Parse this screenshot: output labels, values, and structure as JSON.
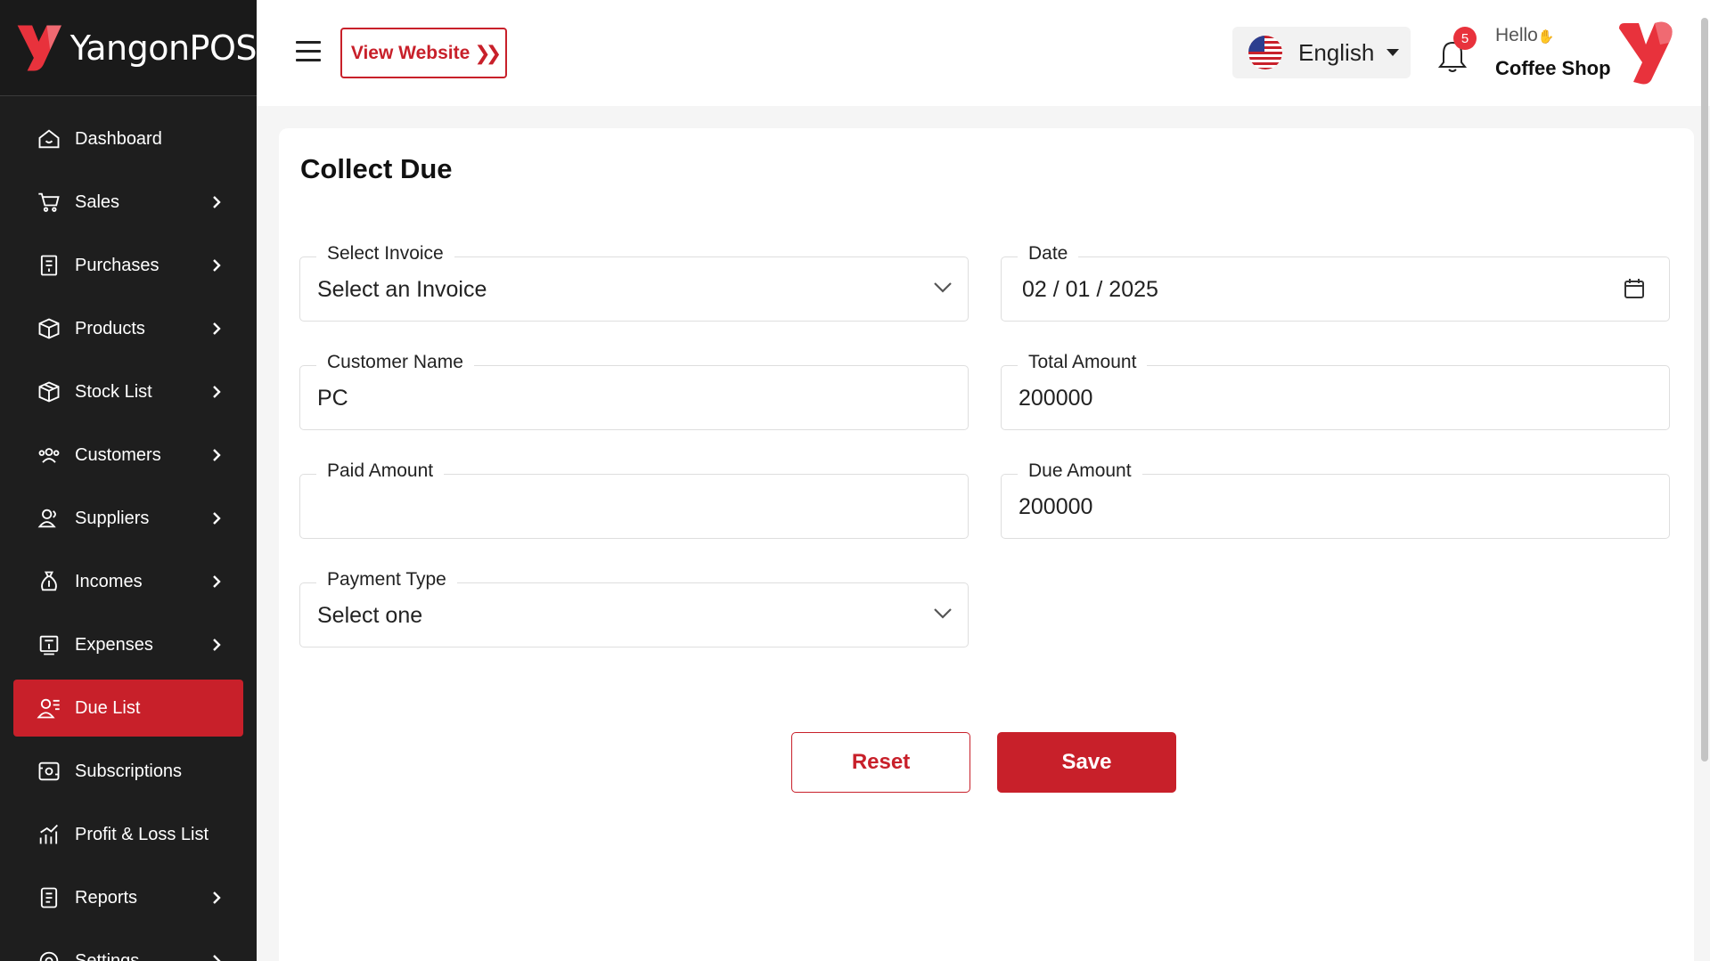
{
  "brand": {
    "name": "YangonPOS",
    "accent": "#c8202a"
  },
  "sidebar": {
    "items": [
      {
        "label": "Dashboard",
        "icon": "home-icon",
        "chevron": false
      },
      {
        "label": "Sales",
        "icon": "cart-icon",
        "chevron": true
      },
      {
        "label": "Purchases",
        "icon": "receipt-icon",
        "chevron": true
      },
      {
        "label": "Products",
        "icon": "box-icon",
        "chevron": true
      },
      {
        "label": "Stock List",
        "icon": "package-icon",
        "chevron": true
      },
      {
        "label": "Customers",
        "icon": "users-icon",
        "chevron": true
      },
      {
        "label": "Suppliers",
        "icon": "user-group-icon",
        "chevron": true
      },
      {
        "label": "Incomes",
        "icon": "money-bag-icon",
        "chevron": true
      },
      {
        "label": "Expenses",
        "icon": "bill-icon",
        "chevron": true
      },
      {
        "label": "Due List",
        "icon": "user-list-icon",
        "chevron": false,
        "active": true
      },
      {
        "label": "Subscriptions",
        "icon": "subscription-icon",
        "chevron": false
      },
      {
        "label": "Profit & Loss List",
        "icon": "chart-icon",
        "chevron": false
      },
      {
        "label": "Reports",
        "icon": "report-icon",
        "chevron": true
      },
      {
        "label": "Settings",
        "icon": "gear-icon",
        "chevron": true
      }
    ]
  },
  "header": {
    "view_website": "View Website",
    "language": "English",
    "notification_count": "5",
    "greeting": "Hello",
    "shop_name": "Coffee Shop"
  },
  "main": {
    "title": "Collect Due",
    "fields": {
      "invoice": {
        "label": "Select Invoice",
        "value": "Select an Invoice"
      },
      "date": {
        "label": "Date",
        "value": "02 / 01 / 2025"
      },
      "customer": {
        "label": "Customer Name",
        "value": "PC"
      },
      "total": {
        "label": "Total Amount",
        "value": "200000"
      },
      "paid": {
        "label": "Paid Amount",
        "value": ""
      },
      "due": {
        "label": "Due Amount",
        "value": "200000"
      },
      "payment_type": {
        "label": "Payment Type",
        "value": "Select one"
      }
    },
    "buttons": {
      "reset": "Reset",
      "save": "Save"
    }
  }
}
